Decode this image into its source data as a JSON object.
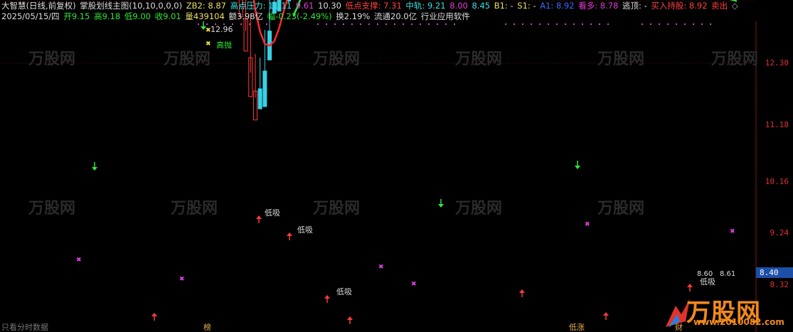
{
  "header1": {
    "app": "大智慧(日线,前复权)",
    "indicator": "掌股划线主图(10,10,0,0,0)",
    "zb2": "ZB2: 8.87",
    "gaodian": "高点压力: 11.11",
    "v961": "9.61",
    "v1030": "10.30",
    "didian": "低点支撑: 7.31",
    "zhonggui": "中轨: 9.21",
    "v800": "8.00",
    "v845": "8.45",
    "b1": "B1: -",
    "s1": "S1: -",
    "a1": "A1: 8.92",
    "kanduo": "看多: 8.78",
    "taoding": "逃顶: -",
    "mairu": "买入持股: 8.92",
    "maichu": "卖出",
    "diamond": "◇"
  },
  "header2": {
    "date": "2025/05/15/四",
    "open": "开9.15",
    "high": "高9.18",
    "low": "低9.00",
    "close": "收9.01",
    "vol": "量439104",
    "amt": "额3.98亿",
    "chg": "幅-0.23(-2.49%)",
    "turn": "换2.19%",
    "float": "流通20.0亿",
    "sector": "行业应用软件"
  },
  "axis": [
    "12.30",
    "11.18",
    "10.16",
    "9.24",
    "8.32"
  ],
  "current_price": "8.40",
  "annotations": {
    "peak": "12.96",
    "gaopao": "高抛",
    "dixi": "低吸",
    "range_lo": "8.60",
    "range_hi": "8.61"
  },
  "bottom": {
    "left": "只看分时数据",
    "bang": "榜",
    "dizhang": "低涨",
    "cai": "财"
  },
  "logo": {
    "name": "万股网",
    "url": "www.2010082.com"
  },
  "colors": {
    "up": "#ff3b3b",
    "down": "#39d1e6",
    "ma": "#ff2a2a",
    "green": "#32e63a",
    "yellow": "#e8e06a",
    "violet": "#c07fe8"
  }
}
